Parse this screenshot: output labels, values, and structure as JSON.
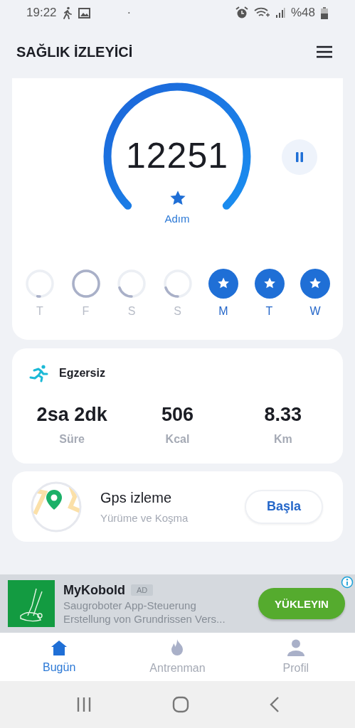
{
  "status_bar": {
    "time": "19:22",
    "dot": "·",
    "battery": "%48"
  },
  "header": {
    "title": "SAĞLIK İZLEYİCİ"
  },
  "steps": {
    "count": "12251",
    "unit": "Adım",
    "paused": false
  },
  "days": [
    {
      "label": "T",
      "kind": "started"
    },
    {
      "label": "F",
      "kind": "full"
    },
    {
      "label": "S",
      "kind": "quarter"
    },
    {
      "label": "S",
      "kind": "quarter"
    },
    {
      "label": "M",
      "kind": "star"
    },
    {
      "label": "T",
      "kind": "star"
    },
    {
      "label": "W",
      "kind": "star"
    }
  ],
  "exercise": {
    "title": "Egzersiz",
    "stats": [
      {
        "value": "2sa 2dk",
        "label": "Süre"
      },
      {
        "value": "506",
        "label": "Kcal"
      },
      {
        "value": "8.33",
        "label": "Km"
      }
    ]
  },
  "gps": {
    "title": "Gps izleme",
    "subtitle": "Yürüme ve Koşma",
    "button": "Başla"
  },
  "ad": {
    "title": "MyKobold",
    "badge": "AD",
    "line_1": "Saugroboter App-Steuerung",
    "line_2": "Erstellung von Grundrissen Vers...",
    "button": "YÜKLEYIN"
  },
  "bottom_nav": [
    {
      "label": "Bugün",
      "selected": true
    },
    {
      "label": "Antrenman",
      "selected": false
    },
    {
      "label": "Profil",
      "selected": false
    }
  ]
}
